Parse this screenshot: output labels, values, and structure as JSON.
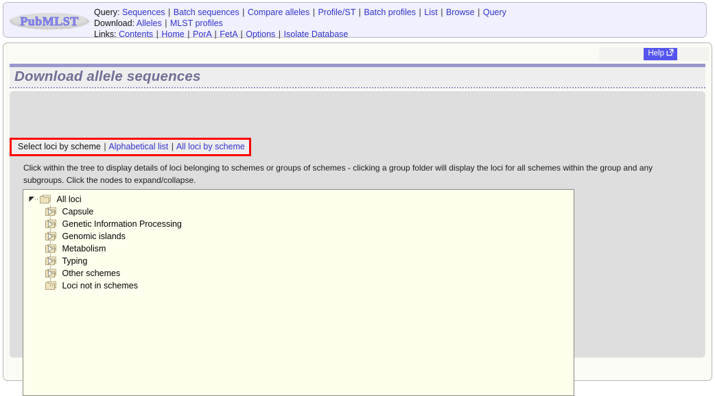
{
  "banner": {
    "logo_text": "PubMLST",
    "nav": [
      {
        "label": "Query:",
        "items": [
          {
            "text": "Sequences",
            "link": true
          },
          {
            "text": "Batch sequences",
            "link": true
          },
          {
            "text": "Compare alleles",
            "link": true
          },
          {
            "text": "Profile/ST",
            "link": true
          },
          {
            "text": "Batch profiles",
            "link": true
          },
          {
            "text": "List",
            "link": true
          },
          {
            "text": "Browse",
            "link": true
          },
          {
            "text": "Query",
            "link": true
          }
        ]
      },
      {
        "label": "Download:",
        "items": [
          {
            "text": "Alleles",
            "link": true
          },
          {
            "text": "MLST profiles",
            "link": true
          }
        ]
      },
      {
        "label": "Links:",
        "items": [
          {
            "text": "Contents",
            "link": true
          },
          {
            "text": "Home",
            "link": true
          },
          {
            "text": "PorA",
            "link": true
          },
          {
            "text": "FetA",
            "link": true
          },
          {
            "text": "Options",
            "link": true
          },
          {
            "text": "Isolate Database",
            "link": true
          }
        ]
      }
    ],
    "separator": "|"
  },
  "header": {
    "help_label": "Help",
    "help_icon": "external-link-icon",
    "title": "Download allele sequences"
  },
  "mode_bar": {
    "items": [
      {
        "text": "Select loci by scheme",
        "link": false
      },
      {
        "text": "Alphabetical list",
        "link": true
      },
      {
        "text": "All loci by scheme",
        "link": true
      }
    ],
    "separator": "|",
    "highlight_color": "#ff0000"
  },
  "instructions": {
    "text": "Click within the tree to display details of loci belonging to schemes or groups of schemes - clicking a group folder will display the loci for all schemes within the group and any subgroups. Click the nodes to expand/collapse."
  },
  "tree": {
    "root": {
      "label": "All loci",
      "state": "expanded",
      "toggle_icon": "triangle-down-icon",
      "folder_icon": "folder-icon"
    },
    "children": [
      {
        "label": "Capsule",
        "state": "collapsed",
        "toggle_icon": "triangle-right-icon",
        "folder_icon": "folder-icon"
      },
      {
        "label": "Genetic Information Processing",
        "state": "collapsed",
        "toggle_icon": "triangle-right-icon",
        "folder_icon": "folder-icon"
      },
      {
        "label": "Genomic islands",
        "state": "collapsed",
        "toggle_icon": "triangle-right-icon",
        "folder_icon": "folder-icon"
      },
      {
        "label": "Metabolism",
        "state": "collapsed",
        "toggle_icon": "triangle-right-icon",
        "folder_icon": "folder-icon"
      },
      {
        "label": "Typing",
        "state": "collapsed",
        "toggle_icon": "triangle-right-icon",
        "folder_icon": "folder-icon"
      },
      {
        "label": "Other schemes",
        "state": "collapsed",
        "toggle_icon": "triangle-right-icon",
        "folder_icon": "folder-icon"
      },
      {
        "label": "Loci not in schemes",
        "state": "leaf",
        "toggle_icon": "none",
        "folder_icon": "folder-icon"
      }
    ]
  },
  "colors": {
    "link": "#3333cc",
    "title": "#6f6f96",
    "accent_bar": "#9898cc",
    "help_bg": "#5555ee",
    "panel_bg": "#dedede",
    "tree_bg": "#ffffee",
    "banner_bg": "#f0f0fe",
    "annotation": "#ff0000"
  }
}
